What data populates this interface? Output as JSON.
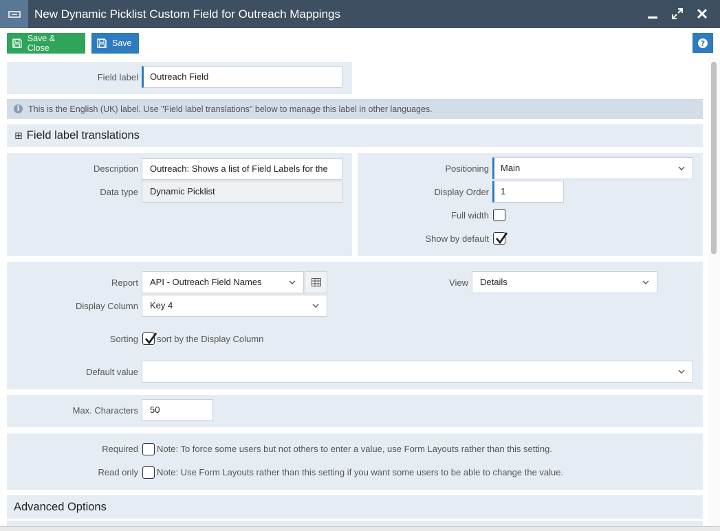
{
  "window": {
    "title": "New Dynamic Picklist Custom Field for Outreach Mappings"
  },
  "toolbar": {
    "save_close_label": "Save & Close",
    "save_label": "Save"
  },
  "field_label": {
    "label": "Field label",
    "value": "Outreach Field"
  },
  "info": {
    "text": "This is the English (UK) label. Use \"Field label translations\" below to manage this label in other languages."
  },
  "translations": {
    "expander": "⊞",
    "title": "Field label translations"
  },
  "general": {
    "description_label": "Description",
    "description_value": "Outreach: Shows a list of Field Labels for the",
    "data_type_label": "Data type",
    "data_type_value": "Dynamic Picklist"
  },
  "layout": {
    "positioning_label": "Positioning",
    "positioning_value": "Main",
    "display_order_label": "Display Order",
    "display_order_value": "1",
    "full_width_label": "Full width",
    "full_width_checked": false,
    "show_by_default_label": "Show by default",
    "show_by_default_checked": true
  },
  "source": {
    "report_label": "Report",
    "report_value": "API - Outreach Field Names",
    "view_label": "View",
    "view_value": "Details",
    "display_column_label": "Display Column",
    "display_column_value": "Key 4",
    "sorting_label": "Sorting",
    "sorting_checked": true,
    "sorting_text": "sort by the Display Column",
    "default_value_label": "Default value",
    "default_value": ""
  },
  "limits": {
    "max_characters_label": "Max. Characters",
    "max_characters_value": "50"
  },
  "flags": {
    "required_label": "Required",
    "required_checked": false,
    "required_note": "Note: To force some users but not others to enter a value, use Form Layouts rather than this setting.",
    "read_only_label": "Read only",
    "read_only_checked": false,
    "read_only_note": "Note: Use Form Layouts rather than this setting if you want some users to be able to change the value."
  },
  "advanced": {
    "title": "Advanced Options"
  },
  "colors": {
    "titlebar": "#3d4f61",
    "accent": "#2e7bbf",
    "save_close": "#2ea55a",
    "panel": "#e6ecf4"
  },
  "icons": [
    "window-icon",
    "minimize-icon",
    "maximize-icon",
    "close-icon",
    "save-icon",
    "help-icon",
    "info-icon",
    "expand-icon",
    "grid-icon",
    "chevron-down-icon",
    "checkmark-icon"
  ]
}
